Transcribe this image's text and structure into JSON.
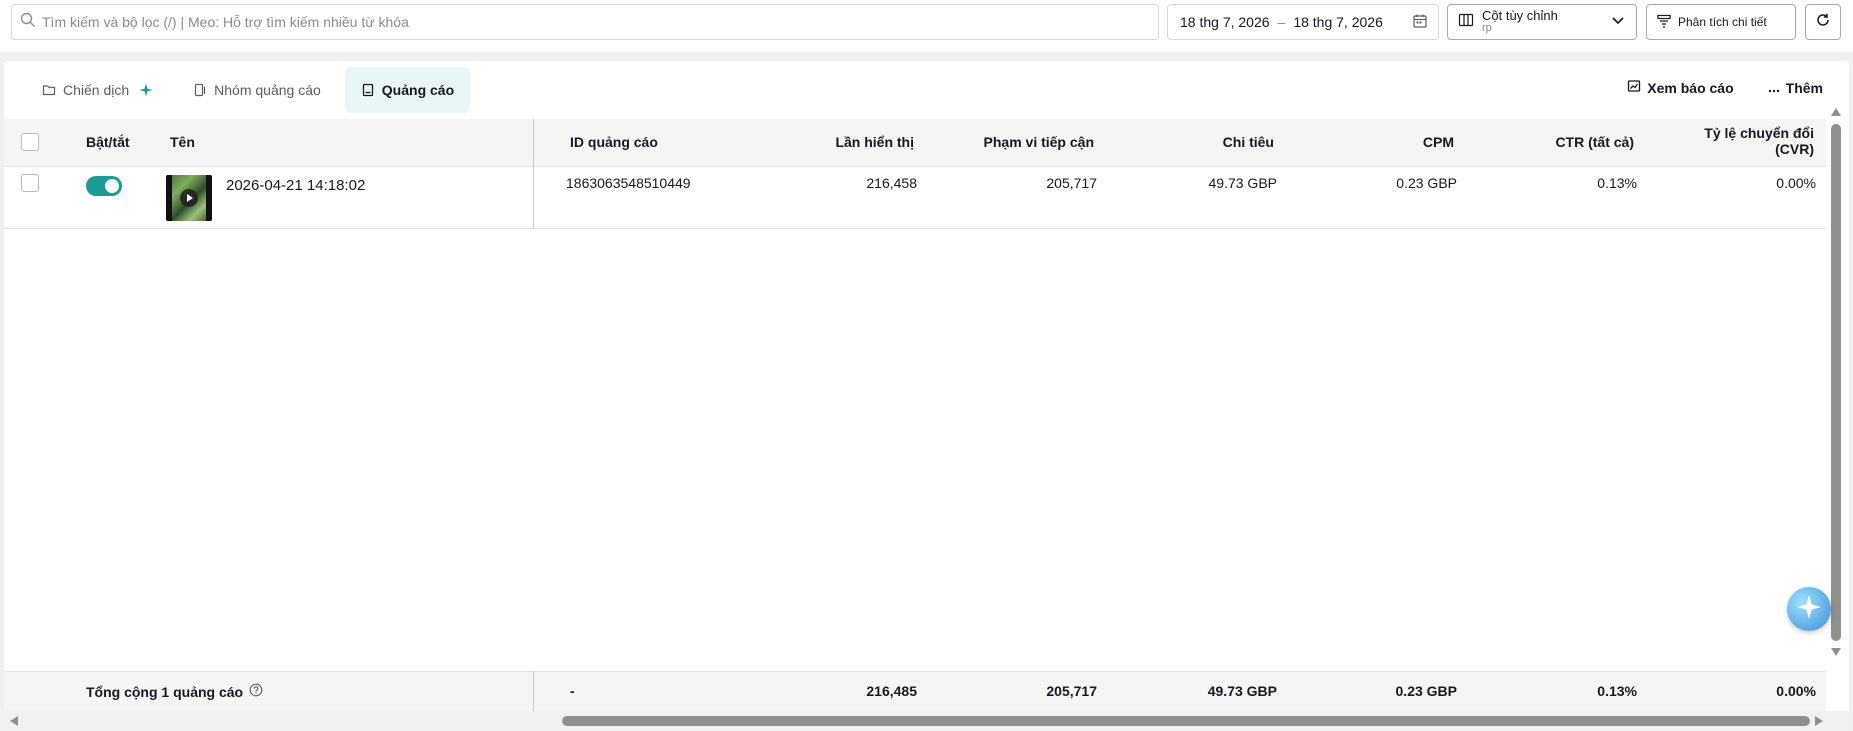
{
  "search": {
    "placeholder": "Tìm kiếm và bộ lọc (/) | Mẹo: Hỗ trợ tìm kiếm nhiều từ khóa"
  },
  "date_range": {
    "start": "18 thg 7, 2026",
    "separator": "–",
    "end": "18 thg 7, 2026"
  },
  "custom_columns": {
    "label": "Cột tùy chỉnh",
    "value": "rp"
  },
  "breakdown": {
    "label": "Phân tích chi tiết"
  },
  "tabs": [
    {
      "label": "Chiến dịch"
    },
    {
      "label": "Nhóm quảng cáo"
    },
    {
      "label": "Quảng cáo"
    }
  ],
  "actions": {
    "view_report": "Xem báo cáo",
    "more": "Thêm"
  },
  "columns": {
    "toggle": "Bật/tắt",
    "name": "Tên",
    "ad_id": "ID quảng cáo",
    "impressions": "Lần hiển thị",
    "reach": "Phạm vi tiếp cận",
    "spend": "Chi tiêu",
    "cpm": "CPM",
    "ctr": "CTR (tất cả)",
    "cvr_line1": "Tỷ lệ chuyển đổi",
    "cvr_line2": "(CVR)"
  },
  "rows": [
    {
      "name": "2026-04-21 14:18:02",
      "ad_id": "1863063548510449",
      "impressions": "216,458",
      "reach": "205,717",
      "spend": "49.73 GBP",
      "cpm": "0.23 GBP",
      "ctr": "0.13%",
      "cvr": "0.00%",
      "enabled": true
    }
  ],
  "totals": {
    "label": "Tổng cộng 1 quảng cáo",
    "ad_id": "-",
    "impressions": "216,485",
    "reach": "205,717",
    "spend": "49.73 GBP",
    "cpm": "0.23 GBP",
    "ctr": "0.13%",
    "cvr": "0.00%"
  },
  "colors": {
    "accent": "#1a9b97",
    "active_tab_bg": "#e8f6f6"
  }
}
